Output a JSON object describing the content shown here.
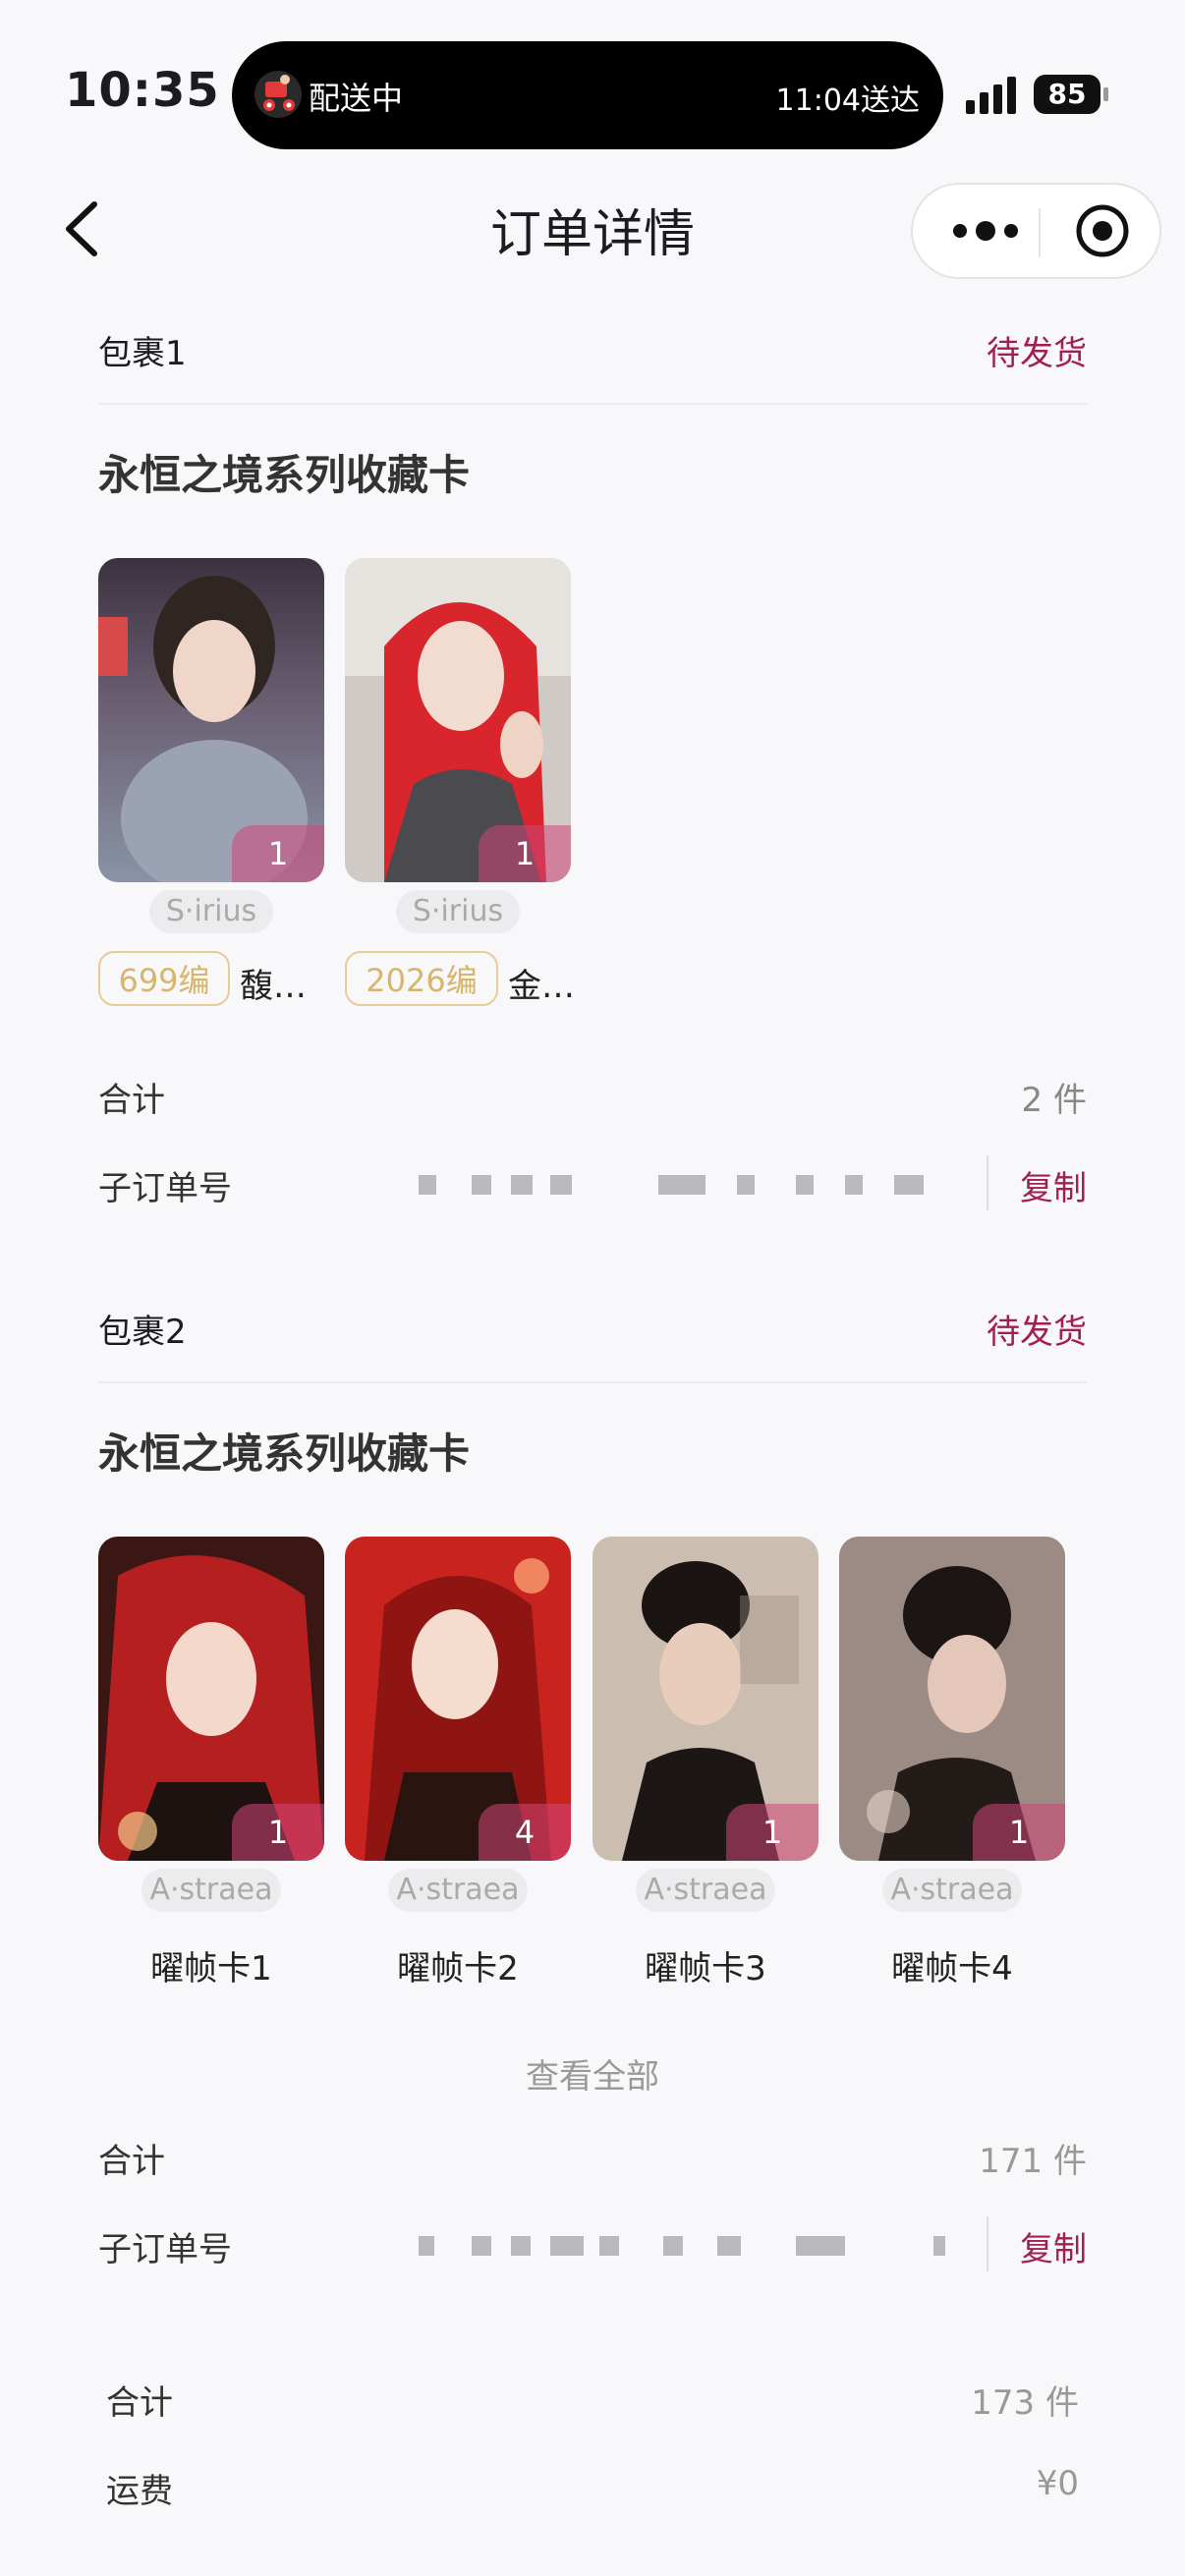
{
  "status_bar": {
    "time": "10:35",
    "delivery_status": "配送中",
    "delivery_eta": "11:04送达",
    "battery": "85"
  },
  "nav": {
    "title": "订单详情",
    "back_icon": "chevron-left-icon",
    "more_icon": "more-dots-icon",
    "close_icon": "target-close-icon"
  },
  "packages": [
    {
      "label": "包裹1",
      "status": "待发货",
      "series": "永恒之境系列收藏卡",
      "cards": [
        {
          "qty": "1",
          "brand": "S·irius",
          "edition": "699编",
          "name": "馥…"
        },
        {
          "qty": "1",
          "brand": "S·irius",
          "edition": "2026编",
          "name": "金…"
        }
      ],
      "total_label": "合计",
      "total_value": "2 件",
      "suborder_label": "子订单号",
      "copy_label": "复制"
    },
    {
      "label": "包裹2",
      "status": "待发货",
      "series": "永恒之境系列收藏卡",
      "cards": [
        {
          "qty": "1",
          "brand": "A·straea",
          "name": "曜帧卡1"
        },
        {
          "qty": "4",
          "brand": "A·straea",
          "name": "曜帧卡2"
        },
        {
          "qty": "1",
          "brand": "A·straea",
          "name": "曜帧卡3"
        },
        {
          "qty": "1",
          "brand": "A·straea",
          "name": "曜帧卡4"
        }
      ],
      "view_all": "查看全部",
      "total_label": "合计",
      "total_value": "171 件",
      "suborder_label": "子订单号",
      "copy_label": "复制"
    }
  ],
  "summary": {
    "total_label": "合计",
    "total_value": "173 件",
    "shipping_label": "运费",
    "shipping_value": "¥0"
  },
  "colors": {
    "accent": "#a1204e",
    "edition_border": "#e6cc96",
    "background": "#f8f8fa"
  }
}
